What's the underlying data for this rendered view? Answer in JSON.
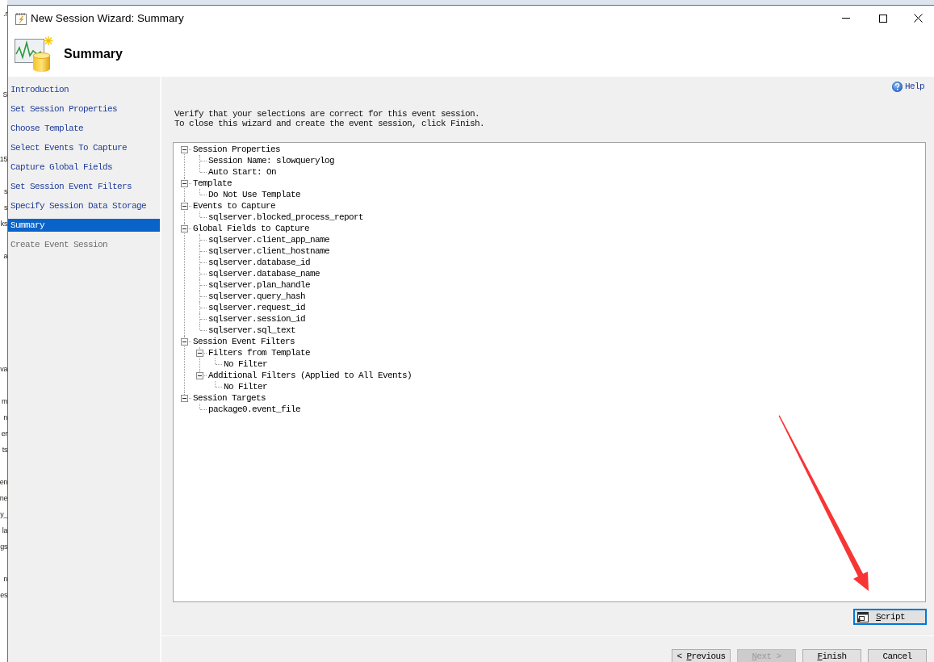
{
  "background_window": {
    "text_fragments": [
      ".r",
      "S",
      "15",
      "s",
      "s",
      "ks",
      "a",
      "va",
      "m",
      "n",
      "er",
      "ts",
      "en",
      "ne",
      "y_",
      "la",
      "gs",
      "n",
      "es"
    ]
  },
  "window": {
    "title": "New Session Wizard: Summary"
  },
  "header": {
    "title": "Summary"
  },
  "nav": {
    "items": [
      {
        "label": "Introduction",
        "selected": false,
        "disabled": false
      },
      {
        "label": "Set Session Properties",
        "selected": false,
        "disabled": false
      },
      {
        "label": "Choose Template",
        "selected": false,
        "disabled": false
      },
      {
        "label": "Select Events To Capture",
        "selected": false,
        "disabled": false
      },
      {
        "label": "Capture Global Fields",
        "selected": false,
        "disabled": false
      },
      {
        "label": "Set Session Event Filters",
        "selected": false,
        "disabled": false
      },
      {
        "label": "Specify Session Data Storage",
        "selected": false,
        "disabled": false
      },
      {
        "label": "Summary",
        "selected": true,
        "disabled": false
      },
      {
        "label": "Create Event Session",
        "selected": false,
        "disabled": true
      }
    ]
  },
  "help_link": {
    "label": "Help"
  },
  "instructions": [
    "Verify that your selections are correct for this event session.",
    "To close this wizard and create the event session, click Finish."
  ],
  "summary_tree": [
    {
      "label": "Session Properties",
      "expanded": true,
      "children": [
        {
          "label": "Session Name: slowquerylog"
        },
        {
          "label": "Auto Start: On"
        }
      ]
    },
    {
      "label": "Template",
      "expanded": true,
      "children": [
        {
          "label": "Do Not Use Template"
        }
      ]
    },
    {
      "label": "Events to Capture",
      "expanded": true,
      "children": [
        {
          "label": "sqlserver.blocked_process_report"
        }
      ]
    },
    {
      "label": "Global Fields to Capture",
      "expanded": true,
      "children": [
        {
          "label": "sqlserver.client_app_name"
        },
        {
          "label": "sqlserver.client_hostname"
        },
        {
          "label": "sqlserver.database_id"
        },
        {
          "label": "sqlserver.database_name"
        },
        {
          "label": "sqlserver.plan_handle"
        },
        {
          "label": "sqlserver.query_hash"
        },
        {
          "label": "sqlserver.request_id"
        },
        {
          "label": "sqlserver.session_id"
        },
        {
          "label": "sqlserver.sql_text"
        }
      ]
    },
    {
      "label": "Session Event Filters",
      "expanded": true,
      "children": [
        {
          "label": "Filters from Template",
          "expanded": true,
          "children": [
            {
              "label": "No Filter"
            }
          ]
        },
        {
          "label": "Additional Filters (Applied to All Events)",
          "expanded": true,
          "children": [
            {
              "label": "No Filter"
            }
          ]
        }
      ]
    },
    {
      "label": "Session Targets",
      "expanded": true,
      "children": [
        {
          "label": "package0.event_file"
        }
      ]
    }
  ],
  "script_button": {
    "access_key": "S",
    "label_end": "cript",
    "focused": true
  },
  "buttons": [
    {
      "label_start": "< ",
      "access_key": "P",
      "label_end": "revious",
      "disabled": false
    },
    {
      "access_key": "N",
      "label_end": "ext >",
      "disabled": true
    },
    {
      "access_key": "F",
      "label_end": "inish",
      "disabled": false
    },
    {
      "label_start": "Cancel",
      "disabled": false
    }
  ]
}
